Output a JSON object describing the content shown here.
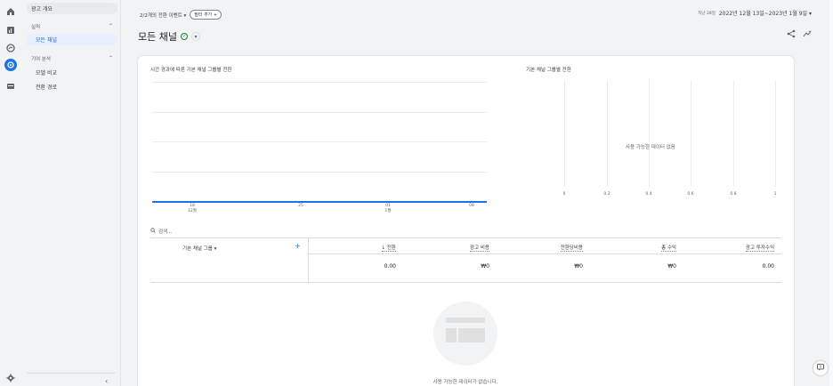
{
  "nav": {
    "ads_overview": "광고 개요",
    "performance_header": "실적",
    "all_channels": "모든 채널",
    "attribution_header": "기여 분석",
    "model_comparison": "모델 비교",
    "conversion_paths": "전환 경로"
  },
  "topbar": {
    "events_label": "2/2개의 전환 이벤트 ▾",
    "add_filter": "필터 추가 +",
    "date_prefix": "지난 28일",
    "date_range": "2022년 12월 13일~2023년 1월 9일 ▾"
  },
  "page": {
    "title": "모든 채널"
  },
  "line_chart": {
    "title": "시간 경과에 따른 기본 채널 그룹별 전환",
    "x_ticks": [
      {
        "day": "18",
        "month": "12월"
      },
      {
        "day": "25",
        "month": ""
      },
      {
        "day": "01",
        "month": "1월"
      },
      {
        "day": "08",
        "month": ""
      }
    ]
  },
  "bar_chart": {
    "title": "기본 채널 그룹별 전환",
    "no_data": "사용 가능한 데이터 없음",
    "x_ticks": [
      "0",
      "0.2",
      "0.4",
      "0.6",
      "0.8",
      "1"
    ]
  },
  "table": {
    "search_placeholder": "검색...",
    "dim_header": "기본 채널 그룹 ▾",
    "headers": [
      "↓ 전환",
      "광고 비용",
      "전환당비용",
      "총 수익",
      "광고 투자수익"
    ],
    "totals": [
      "0.00",
      "₩0",
      "₩0",
      "₩0",
      "0.00"
    ]
  },
  "empty": {
    "message": "사용 가능한 데이터가 없습니다."
  },
  "colors": {
    "accent": "#1a73e8",
    "selected_bg": "#e8f0fe",
    "check": "#188038"
  }
}
